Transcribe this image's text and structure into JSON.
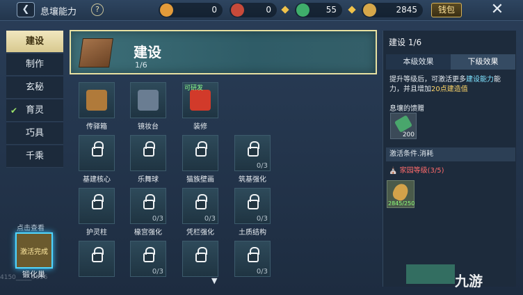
{
  "header": {
    "back_icon": "back-arrow-icon",
    "title": "息壤能力",
    "help_glyph": "?",
    "resources": [
      {
        "icon": "gold-coin-icon",
        "value": "0",
        "color": "#e39b3a"
      },
      {
        "icon": "red-token-icon",
        "value": "0",
        "color": "#c84a3a"
      },
      {
        "icon": "jade-icon",
        "value": "55",
        "color": "#3fae6b"
      },
      {
        "icon": "leaf-currency-icon",
        "value": "2845",
        "color": "#d6a74a"
      }
    ],
    "wallet_label": "钱包",
    "close_glyph": "✕"
  },
  "tabs": [
    {
      "label": "建设",
      "active": true,
      "checked": false
    },
    {
      "label": "制作",
      "active": false,
      "checked": false
    },
    {
      "label": "玄秘",
      "active": false,
      "checked": false
    },
    {
      "label": "育灵",
      "active": false,
      "checked": true
    },
    {
      "label": "巧具",
      "active": false,
      "checked": false
    },
    {
      "label": "千乘",
      "active": false,
      "checked": false
    }
  ],
  "hint_text": "点击查看",
  "activated_label": "激活完成",
  "activated_sub": "锻化巢",
  "watermark_id": "4150_____9556",
  "banner": {
    "name": "建设",
    "count": "1/6"
  },
  "grid_items": [
    {
      "name": "传驿箱",
      "locked": false,
      "count": "",
      "tag": "",
      "pic_color": "#b07a3a"
    },
    {
      "name": "镜妆台",
      "locked": false,
      "count": "",
      "tag": "",
      "pic_color": "#6a7d92"
    },
    {
      "name": "装修",
      "locked": false,
      "count": "",
      "tag": "可研发",
      "pic_color": "#d23a2a"
    },
    {
      "name": "基建核心",
      "locked": true,
      "count": "",
      "tag": ""
    },
    {
      "name": "乐舞球",
      "locked": true,
      "count": "",
      "tag": ""
    },
    {
      "name": "猫族壁画",
      "locked": true,
      "count": "",
      "tag": ""
    },
    {
      "name": "筑基强化",
      "locked": true,
      "count": "0/3",
      "tag": ""
    },
    {
      "name": "护灵柱",
      "locked": true,
      "count": "",
      "tag": ""
    },
    {
      "name": "椽宫强化",
      "locked": true,
      "count": "0/3",
      "tag": ""
    },
    {
      "name": "凭栏强化",
      "locked": true,
      "count": "0/3",
      "tag": ""
    },
    {
      "name": "土质结构",
      "locked": true,
      "count": "0/3",
      "tag": ""
    },
    {
      "name": "",
      "locked": true,
      "count": "",
      "tag": ""
    },
    {
      "name": "",
      "locked": true,
      "count": "0/3",
      "tag": ""
    },
    {
      "name": "",
      "locked": true,
      "count": "",
      "tag": ""
    },
    {
      "name": "",
      "locked": true,
      "count": "0/3",
      "tag": ""
    }
  ],
  "right": {
    "title": "建设 1/6",
    "tab_current": "本级效果",
    "tab_next": "下级效果",
    "desc_a": "提升等级后，可激活更多",
    "desc_hl": "建设能力",
    "desc_b": "能力，并且增加",
    "desc_hl2": "20点建造值",
    "sub_label": "息壤的馈赠",
    "item1_qty": "200",
    "cond_label": "激活条件.消耗",
    "req_text": "家园等级(3/5)",
    "item2_qty": "2845/250"
  },
  "logo_text": "九游"
}
